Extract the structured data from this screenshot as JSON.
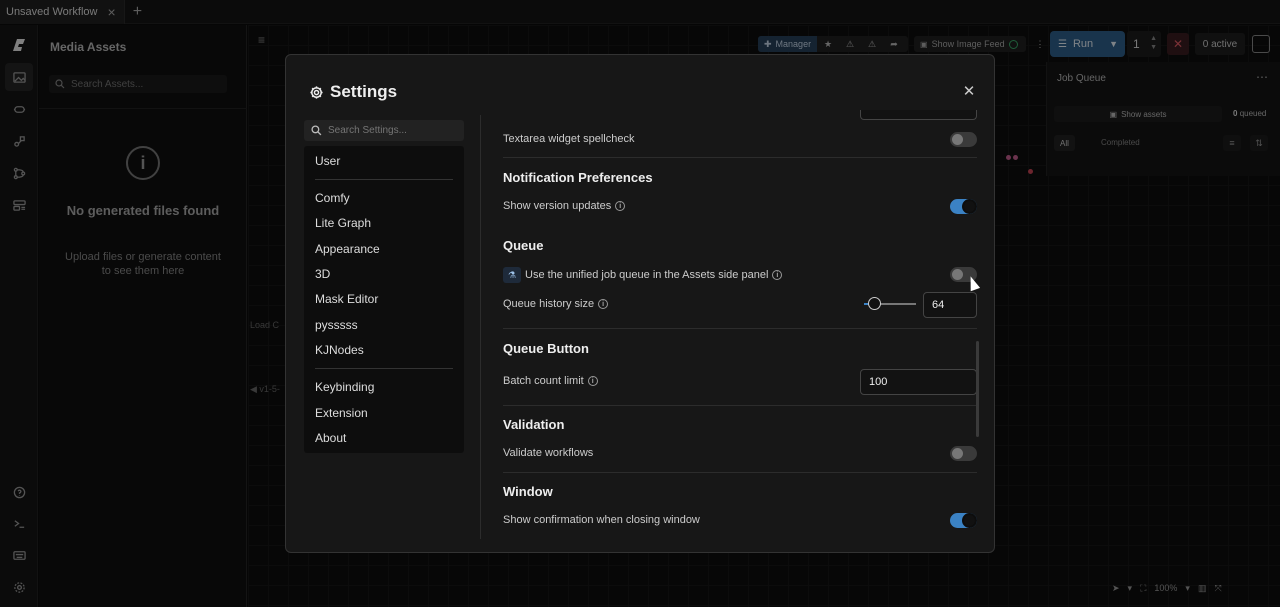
{
  "tabs": [
    {
      "label": "Unsaved Workflow"
    }
  ],
  "assets": {
    "title": "Media Assets",
    "search_placeholder": "Search Assets...",
    "empty_title": "No generated files found",
    "empty_subtitle": "Upload files or generate content to see them here"
  },
  "topbar": {
    "manager_label": "Manager",
    "show_image_feed_label": "Show Image Feed",
    "run_label": "Run",
    "batch_count": "1",
    "active_label": "0 active"
  },
  "job_queue": {
    "title": "Job Queue",
    "show_assets_label": "Show assets",
    "queued_count": "0",
    "queued_suffix": "queued",
    "tab_all": "All",
    "tab_completed": "Completed"
  },
  "canvas": {
    "node_stub_1": "Load C",
    "node_stub_2": "v1-5-",
    "zoom": "100%"
  },
  "settings": {
    "title": "Settings",
    "search_placeholder": "Search Settings...",
    "nav": {
      "user": "User",
      "comfy": "Comfy",
      "lite_graph": "Lite Graph",
      "appearance": "Appearance",
      "three_d": "3D",
      "mask_editor": "Mask Editor",
      "pysssss": "pysssss",
      "kjnodes": "KJNodes",
      "keybinding": "Keybinding",
      "extension": "Extension",
      "about": "About"
    },
    "rows": {
      "textarea_spellcheck": "Textarea widget spellcheck",
      "notification_header": "Notification Preferences",
      "show_version_updates": "Show version updates",
      "queue_header": "Queue",
      "unified_queue": "Use the unified job queue in the Assets side panel",
      "queue_history_size": "Queue history size",
      "queue_history_value": "64",
      "queue_button_header": "Queue Button",
      "batch_count_limit": "Batch count limit",
      "batch_count_limit_value": "100",
      "validation_header": "Validation",
      "validate_workflows": "Validate workflows",
      "window_header": "Window",
      "confirm_close": "Show confirmation when closing window"
    },
    "toggles": {
      "textarea_spellcheck": false,
      "show_version_updates": true,
      "unified_queue": false,
      "validate_workflows": false,
      "confirm_close": true
    },
    "queue_history_slider_fraction": 0.2
  },
  "colors": {
    "accent": "#3b82c4",
    "dialog_bg": "#171717",
    "stop_red": "#e05a63"
  }
}
